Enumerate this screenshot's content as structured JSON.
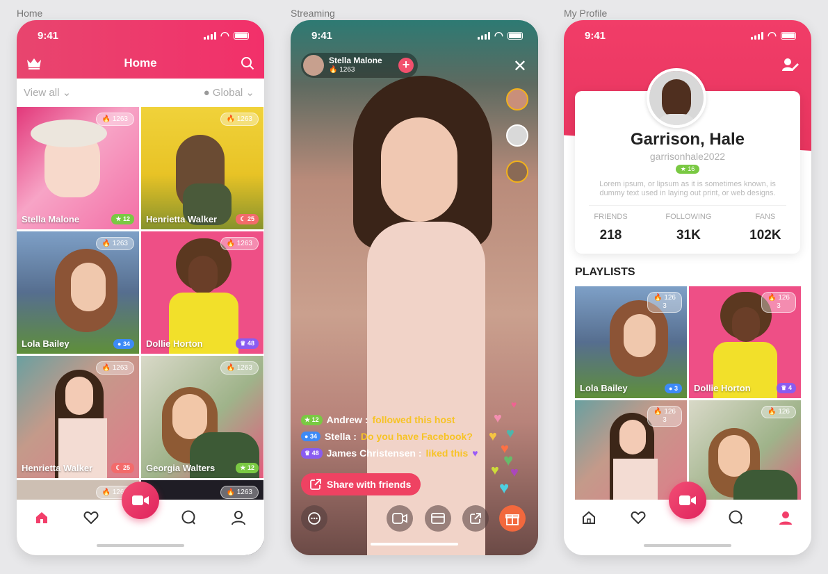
{
  "captions": {
    "home": "Home",
    "streaming": "Streaming",
    "profile": "My Profile"
  },
  "status_time": "9:41",
  "home": {
    "title": "Home",
    "view_all": "View all",
    "region": "Global",
    "tiles": [
      {
        "name": "Stella Malone",
        "count": "1263",
        "level": "12",
        "level_color": "g"
      },
      {
        "name": "Henrietta Walker",
        "count": "1263",
        "level": "25",
        "level_color": "r"
      },
      {
        "name": "Lola Bailey",
        "count": "1263",
        "level": "34",
        "level_color": "b"
      },
      {
        "name": "Dollie Horton",
        "count": "1263",
        "level": "48",
        "level_color": "p"
      },
      {
        "name": "Henrietta Walker",
        "count": "1263",
        "level": "25",
        "level_color": "r"
      },
      {
        "name": "Georgia Walters",
        "count": "1263",
        "level": "12",
        "level_color": "g"
      },
      {
        "name": "",
        "count": "1263",
        "level": "",
        "level_color": "g"
      },
      {
        "name": "",
        "count": "1263",
        "level": "",
        "level_color": "g"
      }
    ]
  },
  "stream": {
    "host_name": "Stella Malone",
    "host_count": "1263",
    "chat": [
      {
        "level": "12",
        "user": "Andrew :",
        "text": "followed this host"
      },
      {
        "level": "34",
        "user": "Stella :",
        "text": "Do you have Facebook?"
      },
      {
        "level": "48",
        "user": "James Christensen :",
        "text": "liked this"
      }
    ],
    "share_label": "Share with friends"
  },
  "profile": {
    "name": "Garrison, Hale",
    "username": "garrisonhale2022",
    "level": "16",
    "bio": "Lorem ipsum, or lipsum as it is sometimes known, is dummy text used in laying out print, or web designs.",
    "stats": [
      {
        "label": "FRIENDS",
        "value": "218"
      },
      {
        "label": "FOLLOWING",
        "value": "31K"
      },
      {
        "label": "FANS",
        "value": "102K"
      }
    ],
    "playlists_title": "PLAYLISTS",
    "playlists": [
      {
        "name": "Lola Bailey",
        "count": "126",
        "items": "3",
        "level": "3"
      },
      {
        "name": "Dollie Horton",
        "count": "126",
        "items": "3",
        "level": "4"
      },
      {
        "name": "",
        "count": "126",
        "items": "3",
        "level": ""
      },
      {
        "name": "",
        "count": "126",
        "items": "",
        "level": ""
      }
    ]
  }
}
